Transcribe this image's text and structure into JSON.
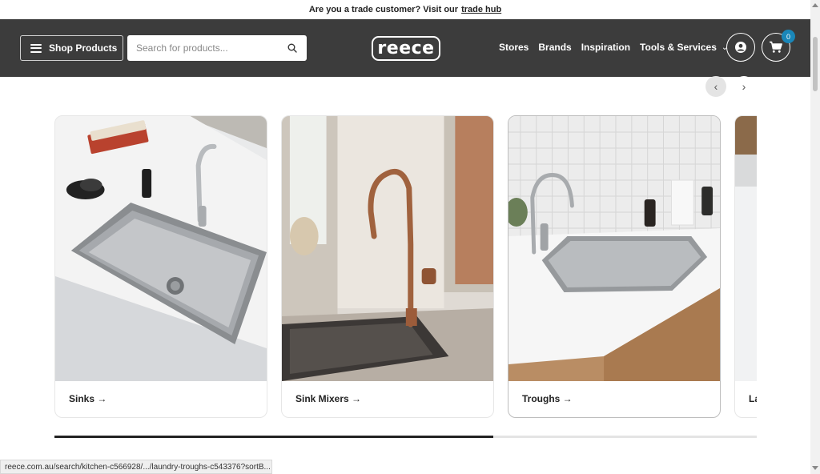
{
  "promo": {
    "text": "Are you a trade customer? Visit our",
    "link": "trade hub"
  },
  "header": {
    "shop_label": "Shop Products",
    "search_placeholder": "Search for products...",
    "logo": "reece",
    "nav": [
      "Stores",
      "Brands",
      "Inspiration",
      "Tools & Services"
    ],
    "cart_count": "0"
  },
  "carousel": {
    "cards": [
      {
        "label": "Sinks →"
      },
      {
        "label": "Sink Mixers →"
      },
      {
        "label": "Troughs →"
      },
      {
        "label": "La"
      }
    ],
    "progress": 0.625
  },
  "status_url": "reece.com.au/search/kitchen-c566928/.../laundry-troughs-c543376?sortB...",
  "colors": {
    "header_bg": "#3c3c3c",
    "badge": "#1a87b9"
  },
  "icons": [
    "hamburger-icon",
    "search-icon",
    "account-icon",
    "cart-icon",
    "chevron-down-icon",
    "chevron-left-icon",
    "chevron-right-icon"
  ]
}
